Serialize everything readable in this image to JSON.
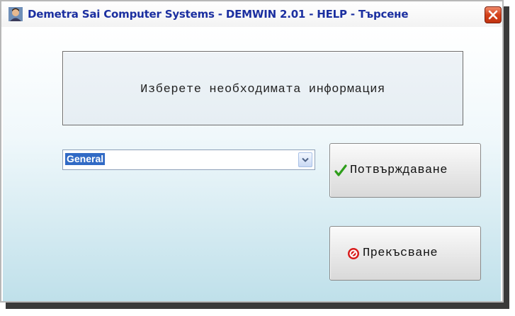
{
  "window": {
    "title": "Demetra Sai Computer Systems - DEMWIN 2.01 - HELP - Търсене",
    "close_icon": "close-icon",
    "app_icon": "user-avatar-icon"
  },
  "info": {
    "prompt": "Изберете необходимата информация"
  },
  "selector": {
    "value": "General",
    "arrow_icon": "chevron-down-icon"
  },
  "buttons": {
    "confirm_label": "Потвърждаване",
    "confirm_icon": "checkmark-icon",
    "cancel_label": "Прекъсване",
    "cancel_icon": "stop-icon"
  },
  "colors": {
    "title_text": "#1b2fa0",
    "close_button": "#d4411a",
    "selection": "#316ac5",
    "confirm_icon": "#2e9e1a",
    "cancel_icon": "#d81b1b"
  }
}
